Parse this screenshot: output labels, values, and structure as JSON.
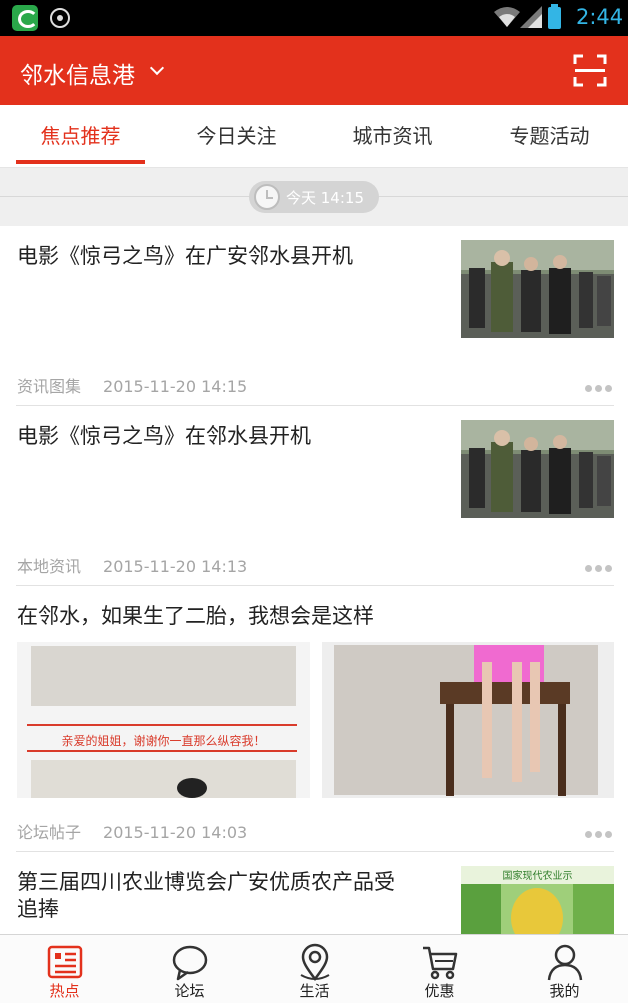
{
  "status_bar": {
    "time": "2:44"
  },
  "header": {
    "title": "邻水信息港",
    "dropdown_icon": "chevron-down-icon",
    "scan_icon": "scan-icon"
  },
  "tabs": [
    {
      "label": "焦点推荐",
      "active": true
    },
    {
      "label": "今日关注",
      "active": false
    },
    {
      "label": "城市资讯",
      "active": false
    },
    {
      "label": "专题活动",
      "active": false
    }
  ],
  "time_divider": {
    "text": "今天 14:15"
  },
  "feed": [
    {
      "title": "电影《惊弓之鸟》在广安邻水县开机",
      "source": "资讯图集",
      "time": "2015-11-20 14:15"
    },
    {
      "title": "电影《惊弓之鸟》在邻水县开机",
      "source": "本地资讯",
      "time": "2015-11-20 14:13"
    },
    {
      "title": "在邻水，如果生了二胎，我想会是这样",
      "image_caption": "亲爱的姐姐，谢谢你一直那么纵容我！",
      "source": "论坛帖子",
      "time": "2015-11-20 14:03"
    },
    {
      "title_line1": "第三届四川农业博览会广安优质农产品受",
      "title_line2": "追捧",
      "thumb_caption": "国家现代农业示"
    }
  ],
  "bottom_nav": [
    {
      "label": "热点",
      "icon": "news-icon",
      "active": true
    },
    {
      "label": "论坛",
      "icon": "chat-bubble-icon",
      "active": false
    },
    {
      "label": "生活",
      "icon": "location-pin-icon",
      "active": false
    },
    {
      "label": "优惠",
      "icon": "shopping-cart-icon",
      "active": false
    },
    {
      "label": "我的",
      "icon": "user-icon",
      "active": false
    }
  ],
  "colors": {
    "brand_red": "#e3311c",
    "status_blue": "#33b5e5"
  }
}
